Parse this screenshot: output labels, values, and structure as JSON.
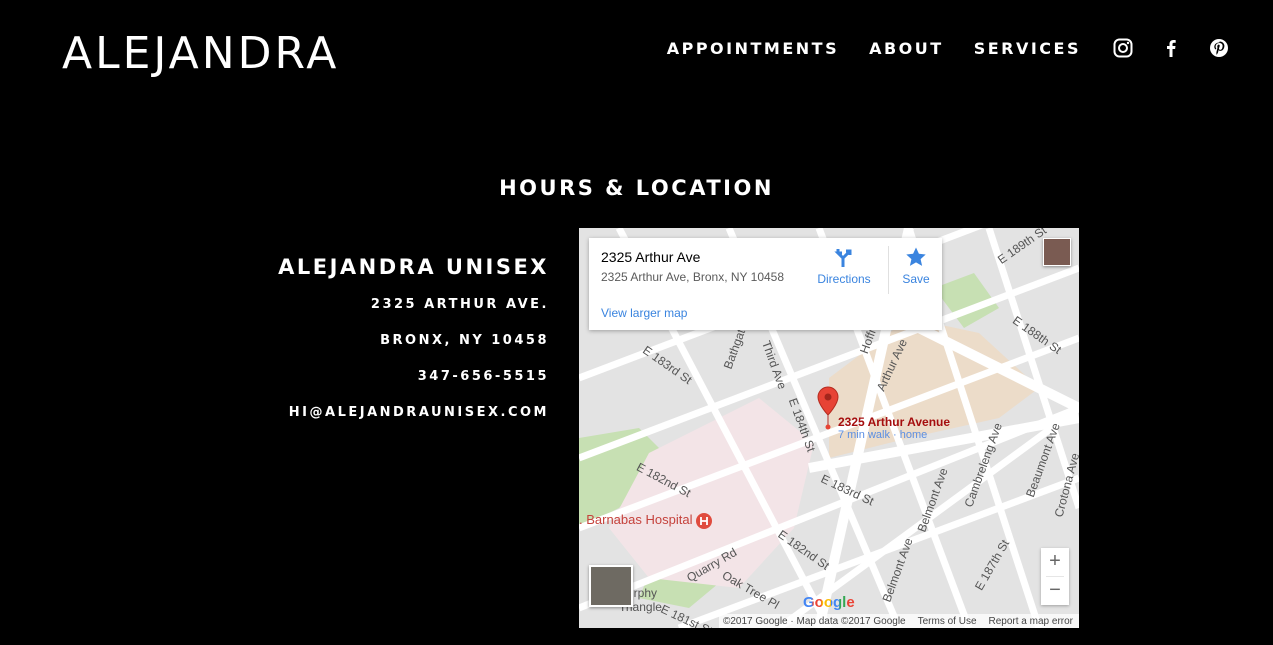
{
  "header": {
    "logo": "ALEJANDRA",
    "nav": [
      "APPOINTMENTS",
      "ABOUT",
      "SERVICES"
    ],
    "social_icons": [
      "instagram-icon",
      "facebook-icon",
      "pinterest-icon"
    ]
  },
  "section": {
    "title": "HOURS & LOCATION"
  },
  "info": {
    "business_name": "ALEJANDRA UNISEX",
    "address_line1": "2325 ARTHUR AVE.",
    "address_line2": "BRONX, NY 10458",
    "phone": "347-656-5515",
    "email": "HI@ALEJANDRAUNISEX.COM"
  },
  "map": {
    "card": {
      "title": "2325 Arthur Ave",
      "address": "2325 Arthur Ave, Bronx, NY 10458",
      "view_larger": "View larger map",
      "directions": "Directions",
      "save": "Save"
    },
    "pin": {
      "name": "2325 Arthur Avenue",
      "walk": "7 min walk · home"
    },
    "hospital": ". Barnabas Hospital",
    "streets": [
      "E 183rd St",
      "Bathgate Ave",
      "Third Ave",
      "E 184th St",
      "Hoffman St",
      "Arthur Ave",
      "E 188th St",
      "E 189th St",
      "E 182nd St",
      "E 183rd St",
      "Cambreleng Ave",
      "Beaumont Ave",
      "Belmont Ave",
      "E 182nd St",
      "Quarry Rd",
      "Oak Tree Pl",
      "E 181st St",
      "Crotona Ave",
      "Belmont Ave",
      "E 187th St",
      "urphy",
      "Triangle"
    ],
    "google": "Google",
    "footer": [
      "©2017 Google · Map data ©2017 Google",
      "Terms of Use",
      "Report a map error"
    ],
    "zoom_in": "+",
    "zoom_out": "−"
  }
}
